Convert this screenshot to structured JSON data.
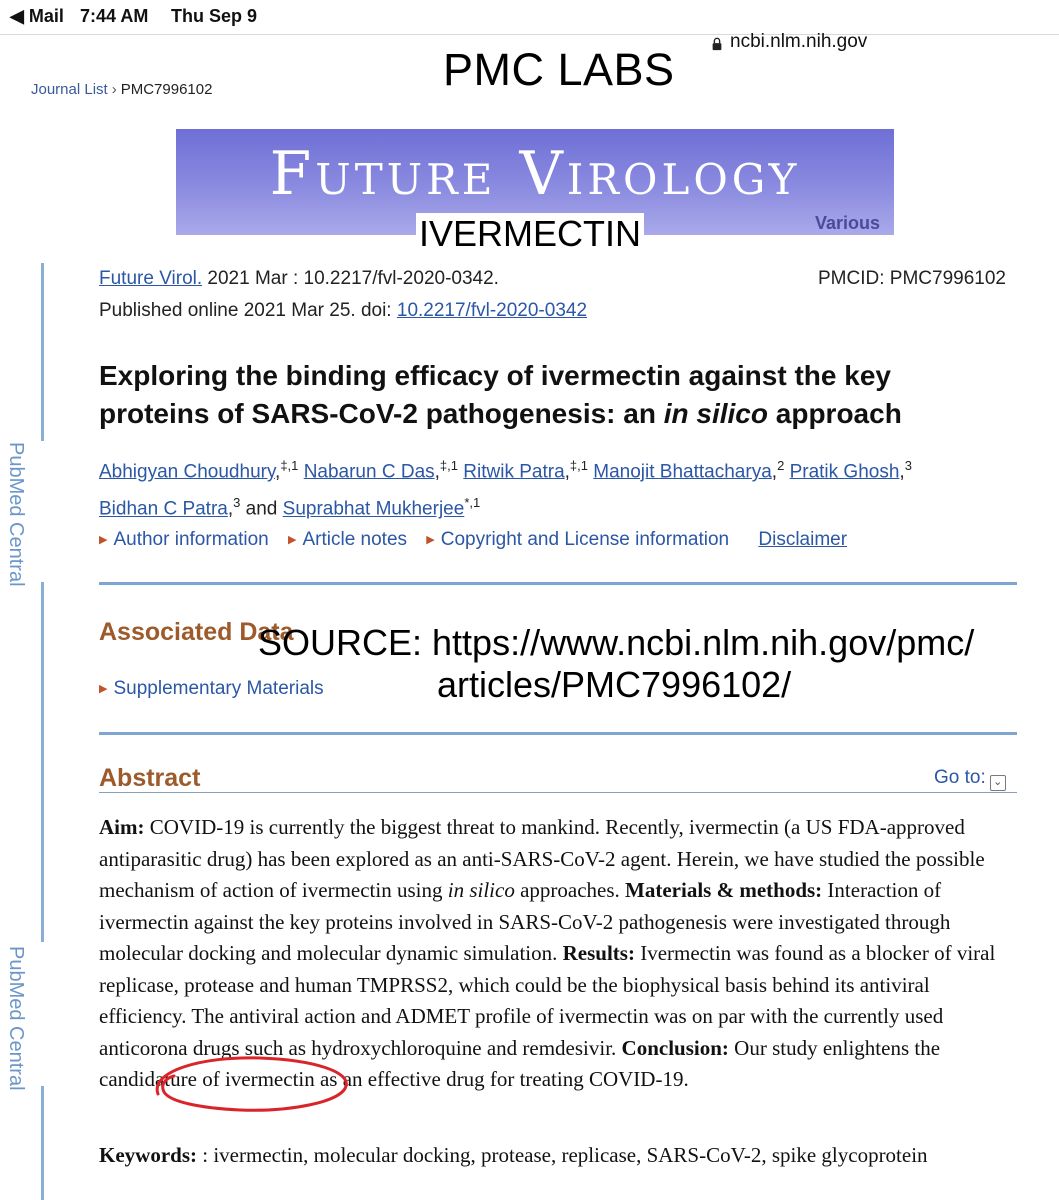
{
  "status_bar": {
    "back_app": "◀ Mail",
    "time": "7:44 AM",
    "day": "Thu Sep 9"
  },
  "browser": {
    "url": "ncbi.nlm.nih.gov"
  },
  "overlays": {
    "pmc_labs": "PMC LABS",
    "ivermectin": "IVERMECTIN",
    "source_line1": "SOURCE: https://www.ncbi.nlm.nih.gov/pmc/",
    "source_line2": "articles/PMC7996102/"
  },
  "breadcrumb": {
    "journal_list": "Journal List",
    "separator": "›",
    "current": "PMC7996102"
  },
  "banner": {
    "title": "Future Virology",
    "tag": "Various"
  },
  "sidebar": {
    "label": "PubMed Central"
  },
  "citation": {
    "journal": "Future Virol.",
    "issue": " 2021 Mar : 10.2217/fvl-2020-0342.",
    "pmcid": "PMCID: PMC7996102",
    "published": "Published online 2021 Mar 25. doi: ",
    "doi": "10.2217/fvl-2020-0342"
  },
  "article": {
    "title_part1": "Exploring the binding efficacy of ivermectin against the key proteins of SARS-CoV-2 pathogenesis: an ",
    "title_italic": "in silico",
    "title_part2": " approach"
  },
  "authors": [
    {
      "name": "Abhigyan Choudhury",
      "sup": "‡,1",
      "sep": ", "
    },
    {
      "name": "Nabarun C Das",
      "sup": "‡,1",
      "sep": ", "
    },
    {
      "name": "Ritwik Patra",
      "sup": "‡,1",
      "sep": ", "
    },
    {
      "name": "Manojit Bhattacharya",
      "sup": "2",
      "sep": ", "
    },
    {
      "name": "Pratik Ghosh",
      "sup": "3",
      "sep": " "
    },
    {
      "name": "Bidhan C Patra",
      "sup": "3",
      "sep": " and "
    },
    {
      "name": "Suprabhat Mukherjee",
      "sup": "*,1",
      "sep": ""
    }
  ],
  "info_links": {
    "author_info": "Author information",
    "article_notes": "Article notes",
    "copyright": "Copyright and License information",
    "disclaimer": "Disclaimer"
  },
  "associated_data": {
    "heading": "Associated Data",
    "supplementary": "Supplementary Materials"
  },
  "abstract": {
    "heading": "Abstract",
    "goto": "Go to:",
    "aim_label": "Aim:",
    "aim_text": " COVID-19 is currently the biggest threat to mankind. Recently, ivermectin (a US FDA-approved antiparasitic drug) has been explored as an anti-SARS-CoV-2 agent. Herein, we have studied the possible mechanism of action of ivermectin using ",
    "aim_italic": "in silico",
    "aim_text2": " approaches. ",
    "methods_label": "Materials & methods:",
    "methods_text": " Interaction of ivermectin against the key proteins involved in SARS-CoV-2 pathogenesis were investigated through molecular docking and molecular dynamic simulation. ",
    "results_label": "Results:",
    "results_text": " Ivermectin was found as a blocker of viral replicase, protease and human TMPRSS2, which could be the biophysical basis behind its antiviral efficiency. The antiviral action and ADMET profile of ivermectin was on par with the currently used anticorona drugs such as hydroxychloroquine and remdesivir. ",
    "conclusion_label": "Conclusion:",
    "conclusion_text": " Our study enlightens the candidature of ivermectin as an effective drug for treating COVID-19."
  },
  "keywords": {
    "label": "Keywords:",
    "text": "  : ivermectin, molecular docking, protease, replicase, SARS-CoV-2, spike glycoprotein"
  },
  "colors": {
    "link": "#2b57a6",
    "section_heading": "#9d5a2a",
    "rule": "#7fa6d2",
    "banner": "#7b7bdc",
    "annotation_circle": "#d9252a"
  }
}
